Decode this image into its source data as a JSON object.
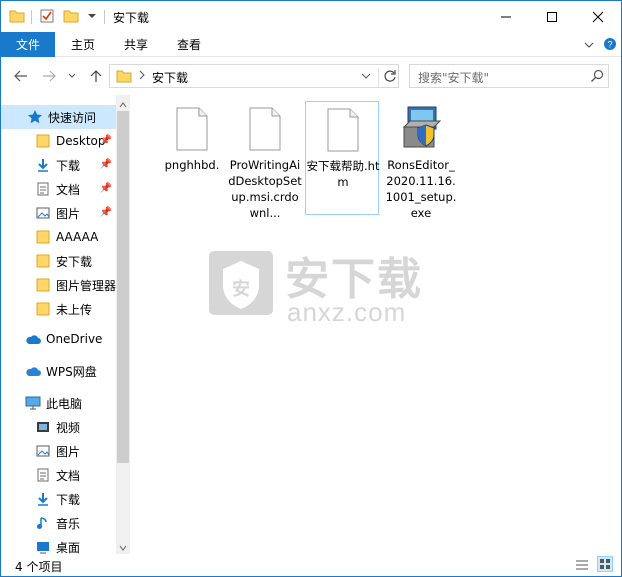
{
  "window": {
    "title": "安下载"
  },
  "ribbon": {
    "tabs": [
      "文件",
      "主页",
      "共享",
      "查看"
    ]
  },
  "address": {
    "location": "安下载",
    "search_placeholder": "搜索\"安下载\""
  },
  "nav": {
    "items": [
      {
        "label": "快速访问",
        "icon": "star-icon",
        "selected": true
      },
      {
        "label": "Desktop",
        "icon": "folder-icon",
        "pinned": true
      },
      {
        "label": "下载",
        "icon": "download-icon",
        "pinned": true
      },
      {
        "label": "文档",
        "icon": "document-icon",
        "pinned": true
      },
      {
        "label": "图片",
        "icon": "picture-icon",
        "pinned": true
      },
      {
        "label": "AAAAA",
        "icon": "folder-icon"
      },
      {
        "label": "安下载",
        "icon": "folder-icon"
      },
      {
        "label": "图片管理器",
        "icon": "folder-icon"
      },
      {
        "label": "未上传",
        "icon": "folder-icon"
      },
      {
        "label": "OneDrive",
        "icon": "cloud-icon"
      },
      {
        "label": "WPS网盘",
        "icon": "cloud-icon"
      },
      {
        "label": "此电脑",
        "icon": "computer-icon"
      },
      {
        "label": "视频",
        "icon": "video-icon"
      },
      {
        "label": "图片",
        "icon": "picture-icon"
      },
      {
        "label": "文档",
        "icon": "document-icon"
      },
      {
        "label": "下载",
        "icon": "download-icon"
      },
      {
        "label": "音乐",
        "icon": "music-icon"
      },
      {
        "label": "桌面",
        "icon": "desktop-icon"
      }
    ]
  },
  "files": [
    {
      "name": "pnghhbd.",
      "icon": "blank-file-icon"
    },
    {
      "name": "ProWritingAidDesktopSetup.msi.crdownl...",
      "icon": "blank-file-icon"
    },
    {
      "name": "安下载帮助.htm",
      "icon": "blank-file-icon",
      "focused": true
    },
    {
      "name": "RonsEditor_2020.11.16.1001_setup.exe",
      "icon": "installer-icon"
    }
  ],
  "watermark": {
    "cn": "安下载",
    "en": "anxz.com"
  },
  "status": {
    "count_text": "4 个项目"
  },
  "colors": {
    "accent": "#1979ca",
    "selection": "#cce8ff",
    "folder": "#ffd767"
  }
}
